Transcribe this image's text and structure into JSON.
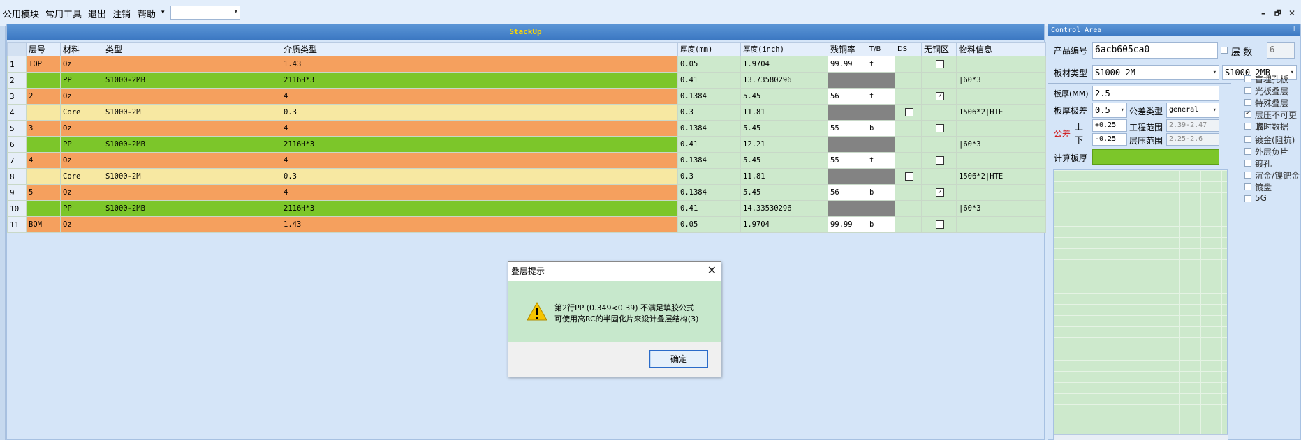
{
  "menu": {
    "items": [
      "公用模块",
      "常用工具",
      "退出",
      "注销",
      "帮助"
    ],
    "combo_value": "",
    "window_controls": [
      "–",
      "🗗",
      "✕"
    ]
  },
  "stackup": {
    "title": "StackUp",
    "columns": [
      "层号",
      "材料",
      "类型",
      "介质类型",
      "厚度(mm)",
      "厚度(inch)",
      "残铜率",
      "T/B",
      "DS",
      "无铜区",
      "物料信息"
    ],
    "rows": [
      {
        "num": "1",
        "layer": "TOP",
        "material": "Oz",
        "type": "",
        "medium": "1.43",
        "mm": "0.05",
        "inch": "1.9704",
        "cu": "99.99",
        "tb": "t",
        "ds": "",
        "nocu": "unchecked",
        "info": "",
        "color": "orange"
      },
      {
        "num": "2",
        "layer": "",
        "material": "PP",
        "type": "S1000-2MB",
        "medium": "2116H*3",
        "mm": "0.41",
        "inch": "13.73580296",
        "cu": "",
        "tb": "",
        "ds": "",
        "nocu": "",
        "info": "|60*3",
        "color": "green"
      },
      {
        "num": "3",
        "layer": "2",
        "material": "Oz",
        "type": "",
        "medium": "4",
        "mm": "0.1384",
        "inch": "5.45",
        "cu": "56",
        "tb": "t",
        "ds": "",
        "nocu": "checked",
        "info": "",
        "color": "orange"
      },
      {
        "num": "4",
        "layer": "",
        "material": "Core",
        "type": "S1000-2M",
        "medium": "0.3",
        "mm": "0.3",
        "inch": "11.81",
        "cu": "",
        "tb": "",
        "ds": "unchecked",
        "nocu": "",
        "info": "1506*2|HTE",
        "color": "yellow"
      },
      {
        "num": "5",
        "layer": "3",
        "material": "Oz",
        "type": "",
        "medium": "4",
        "mm": "0.1384",
        "inch": "5.45",
        "cu": "55",
        "tb": "b",
        "ds": "",
        "nocu": "unchecked",
        "info": "",
        "color": "orange"
      },
      {
        "num": "6",
        "layer": "",
        "material": "PP",
        "type": "S1000-2MB",
        "medium": "2116H*3",
        "mm": "0.41",
        "inch": "12.21",
        "cu": "",
        "tb": "",
        "ds": "",
        "nocu": "",
        "info": "|60*3",
        "color": "green"
      },
      {
        "num": "7",
        "layer": "4",
        "material": "Oz",
        "type": "",
        "medium": "4",
        "mm": "0.1384",
        "inch": "5.45",
        "cu": "55",
        "tb": "t",
        "ds": "",
        "nocu": "unchecked",
        "info": "",
        "color": "orange"
      },
      {
        "num": "8",
        "layer": "",
        "material": "Core",
        "type": "S1000-2M",
        "medium": "0.3",
        "mm": "0.3",
        "inch": "11.81",
        "cu": "",
        "tb": "",
        "ds": "unchecked",
        "nocu": "",
        "info": "1506*2|HTE",
        "color": "yellow"
      },
      {
        "num": "9",
        "layer": "5",
        "material": "Oz",
        "type": "",
        "medium": "4",
        "mm": "0.1384",
        "inch": "5.45",
        "cu": "56",
        "tb": "b",
        "ds": "",
        "nocu": "checked",
        "info": "",
        "color": "orange"
      },
      {
        "num": "10",
        "layer": "",
        "material": "PP",
        "type": "S1000-2MB",
        "medium": "2116H*3",
        "mm": "0.41",
        "inch": "14.33530296",
        "cu": "",
        "tb": "",
        "ds": "",
        "nocu": "",
        "info": "|60*3",
        "color": "green"
      },
      {
        "num": "11",
        "layer": "BOM",
        "material": "Oz",
        "type": "",
        "medium": "1.43",
        "mm": "0.05",
        "inch": "1.9704",
        "cu": "99.99",
        "tb": "b",
        "ds": "",
        "nocu": "unchecked",
        "info": "",
        "color": "orange"
      }
    ]
  },
  "dialog": {
    "title": "叠层提示",
    "line1": "第2行PP (0.349<0.39) 不满足填胶公式",
    "line2": "可使用高RC的半固化片来设计叠层结构(3)",
    "ok_label": "确定"
  },
  "control": {
    "title": "Control Area",
    "product_label": "产品编号",
    "product_value": "6acb605ca0",
    "layer_count_label": "层  数",
    "layer_count_value": "6",
    "material_label": "板材类型",
    "material_value": "S1000-2M",
    "material_value2": "S1000-2MB",
    "thickness_label": "板厚(MM)",
    "thickness_value": "2.5",
    "thick_tol_label": "板厚极差",
    "thick_tol_value": "0.5",
    "tol_type_label": "公差类型",
    "tol_type_value": "general",
    "tolerance_label": "公差",
    "upper_label": "上",
    "lower_label": "下",
    "upper_value": "+0.25",
    "lower_value": "-0.25",
    "eng_range_label": "工程范围",
    "eng_range_value": "2.39-2.47",
    "press_range_label": "层压范围",
    "press_range_value": "2.25-2.6",
    "calc_label": "计算板厚",
    "options": [
      {
        "label": "盲埋孔板",
        "checked": false
      },
      {
        "label": "光板叠层",
        "checked": false
      },
      {
        "label": "特殊叠层",
        "checked": false
      },
      {
        "label": "层压不可更改",
        "checked": true
      },
      {
        "label": "临时数据",
        "checked": false
      },
      {
        "label": "镀金(阻抗)",
        "checked": false
      },
      {
        "label": "外层负片",
        "checked": false
      },
      {
        "label": "镀孔",
        "checked": false
      },
      {
        "label": "沉金/镍钯金",
        "checked": false
      },
      {
        "label": "镀盘",
        "checked": false
      },
      {
        "label": "5G",
        "checked": false
      }
    ],
    "colors": {
      "accent_green": "#7cc62a",
      "copper_orange": "#f5a05e",
      "core_yellow": "#f7e8a2"
    }
  }
}
